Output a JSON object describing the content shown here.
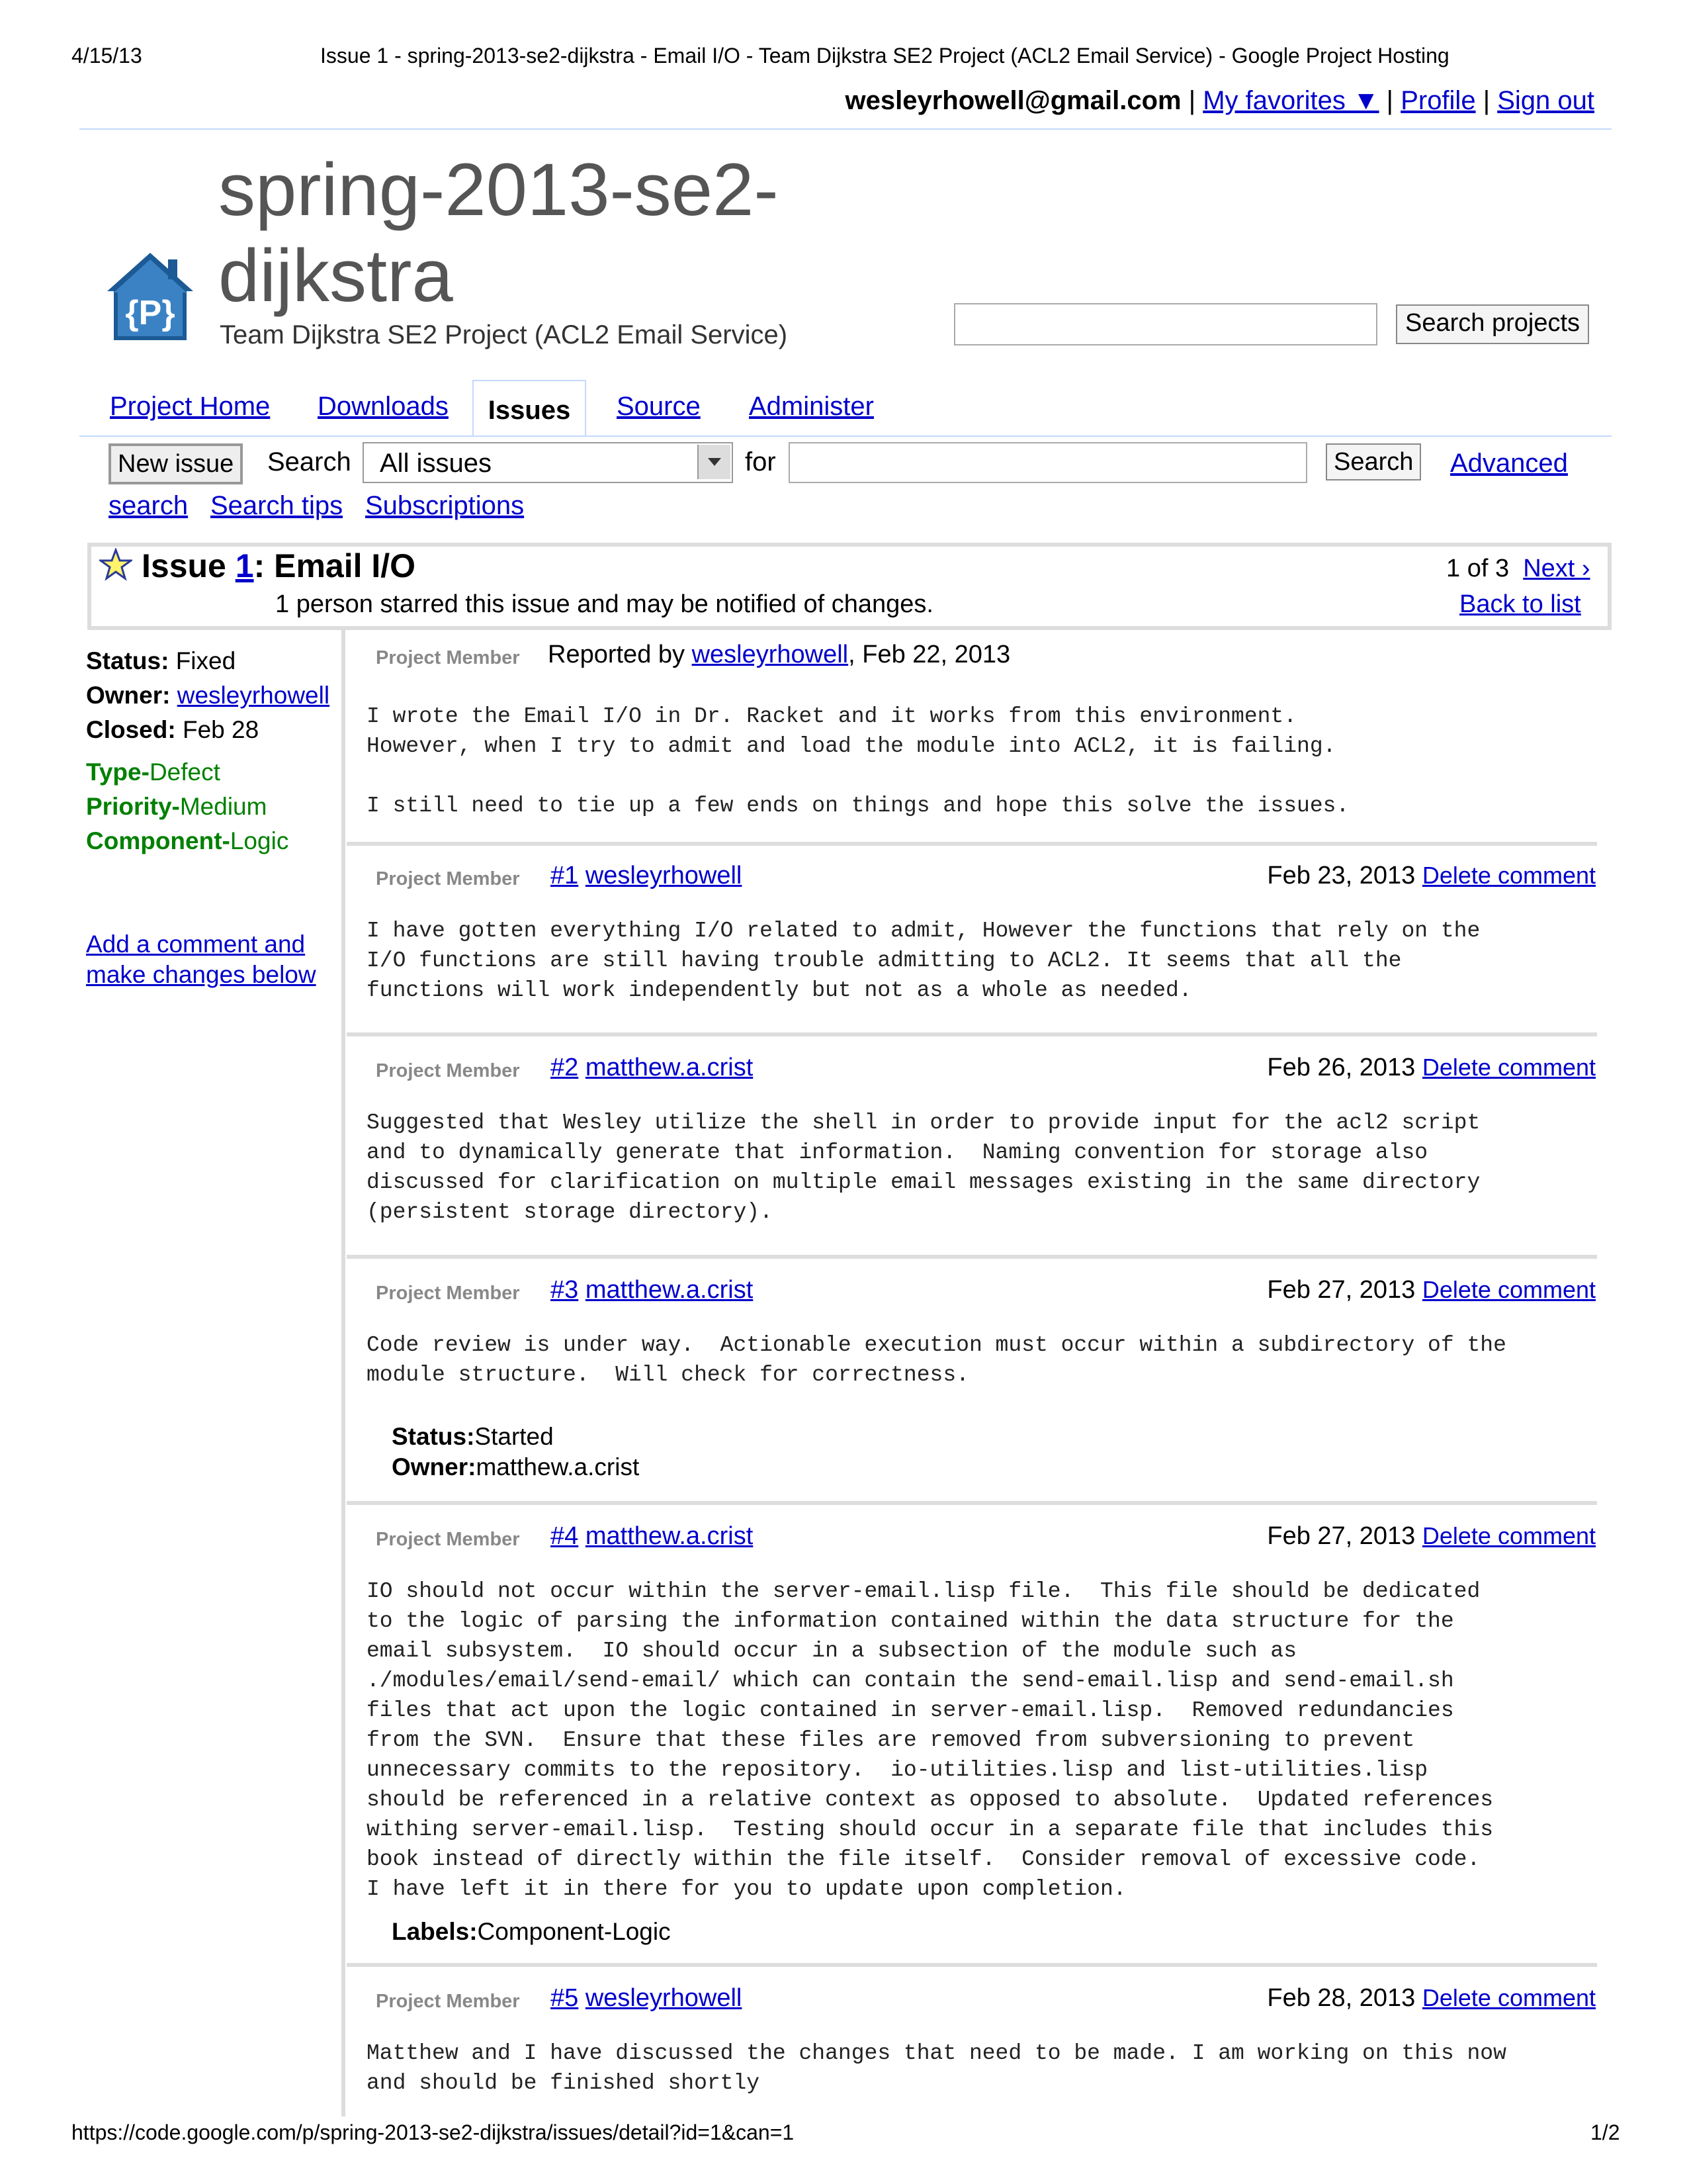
{
  "print": {
    "date": "4/15/13",
    "title": "Issue 1 - spring-2013-se2-dijkstra - Email I/O - Team Dijkstra SE2 Project (ACL2 Email Service) - Google Project Hosting",
    "url": "https://code.google.com/p/spring-2013-se2-dijkstra/issues/detail?id=1&can=1",
    "page": "1/2"
  },
  "account": {
    "email": "wesleyrhowell@gmail.com",
    "sep": "|",
    "favorites": "My favorites ▼",
    "profile": "Profile",
    "sign_out": "Sign out"
  },
  "project": {
    "name_line1": "spring-2013-se2-",
    "name_line2": "dijkstra",
    "summary": "Team Dijkstra SE2 Project (ACL2 Email Service)",
    "logo_letter": "{P}",
    "search_button": "Search projects"
  },
  "tabs": {
    "home": "Project Home",
    "downloads": "Downloads",
    "issues": "Issues",
    "source": "Source",
    "administer": "Administer"
  },
  "search_bar": {
    "new_issue": "New issue",
    "search_label": "Search",
    "scope": "All issues",
    "for_label": "for",
    "search_button": "Search",
    "advanced": "Advanced",
    "search_link": "search",
    "tips": "Search tips",
    "subscriptions": "Subscriptions"
  },
  "issue": {
    "prefix": "Issue ",
    "id": "1",
    "title": ": Email I/O",
    "stars_note": "1 person starred this issue and may be notified of changes.",
    "pager_count": "1 of 3",
    "next": "Next ›",
    "back": "Back to list"
  },
  "meta": {
    "status_label": "Status:",
    "status": "Fixed",
    "owner_label": "Owner:",
    "owner": "wesleyrhowell",
    "closed_label": "Closed:",
    "closed": "Feb 28",
    "labels": [
      {
        "key": "Type-",
        "value": "Defect"
      },
      {
        "key": "Priority-",
        "value": "Medium"
      },
      {
        "key": "Component-",
        "value": "Logic"
      }
    ],
    "add_comment_line1": "Add a comment and",
    "add_comment_line2": "make changes below"
  },
  "report": {
    "role": "Project Member",
    "reported_by": "Reported by ",
    "author": "wesleyrhowell",
    "date": ", Feb 22, 2013",
    "body": "I wrote the Email I/O in Dr. Racket and it works from this environment.\nHowever, when I try to admit and load the module into ACL2, it is failing.\n\nI still need to tie up a few ends on things and hope this solve the issues."
  },
  "comments": [
    {
      "role": "Project Member",
      "num": "#1",
      "author": "wesleyrhowell",
      "date": "Feb 23, 2013",
      "delete": "Delete comment",
      "body": "I have gotten everything I/O related to admit, However the functions that rely on the\nI/O functions are still having trouble admitting to ACL2. It seems that all the\nfunctions will work independently but not as a whole as needed."
    },
    {
      "role": "Project Member",
      "num": "#2",
      "author": "matthew.a.crist",
      "date": "Feb 26, 2013",
      "delete": "Delete comment",
      "body": "Suggested that Wesley utilize the shell in order to provide input for the acl2 script\nand to dynamically generate that information.  Naming convention for storage also\ndiscussed for clarification on multiple email messages existing in the same directory\n(persistent storage directory)."
    },
    {
      "role": "Project Member",
      "num": "#3",
      "author": "matthew.a.crist",
      "date": "Feb 27, 2013",
      "delete": "Delete comment",
      "body": "Code review is under way.  Actionable execution must occur within a subdirectory of the\nmodule structure.  Will check for correctness.",
      "status_label": "Status:",
      "status": "Started",
      "owner_label": "Owner:",
      "owner": "matthew.a.crist"
    },
    {
      "role": "Project Member",
      "num": "#4",
      "author": "matthew.a.crist",
      "date": "Feb 27, 2013",
      "delete": "Delete comment",
      "body": "IO should not occur within the server-email.lisp file.  This file should be dedicated\nto the logic of parsing the information contained within the data structure for the\nemail subsystem.  IO should occur in a subsection of the module such as\n./modules/email/send-email/ which can contain the send-email.lisp and send-email.sh\nfiles that act upon the logic contained in server-email.lisp.  Removed redundancies\nfrom the SVN.  Ensure that these files are removed from subversioning to prevent\nunnecessary commits to the repository.  io-utilities.lisp and list-utilities.lisp\nshould be referenced in a relative context as opposed to absolute.  Updated references\nwithing server-email.lisp.  Testing should occur in a separate file that includes this\nbook instead of directly within the file itself.  Consider removal of excessive code.\nI have left it in there for you to update upon completion.",
      "labels_label": "Labels:",
      "labels": "Component-Logic"
    },
    {
      "role": "Project Member",
      "num": "#5",
      "author": "wesleyrhowell",
      "date": "Feb 28, 2013",
      "delete": "Delete comment",
      "body": "Matthew and I have discussed the changes that need to be made. I am working on this now\nand should be finished shortly"
    }
  ]
}
